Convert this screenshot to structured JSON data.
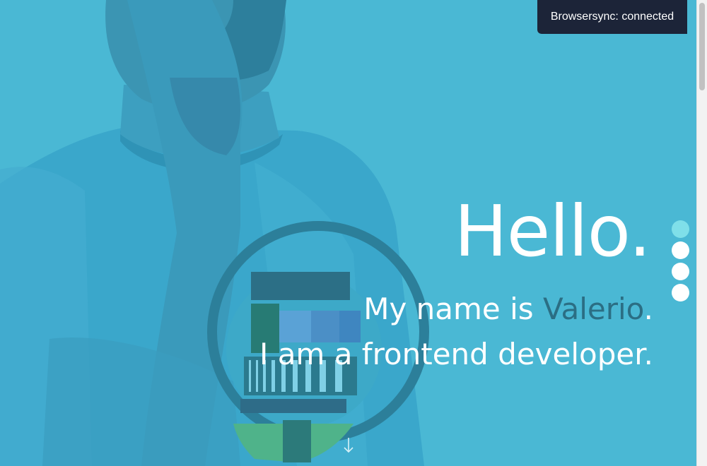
{
  "notification": {
    "text": "Browsersync: connected"
  },
  "hero": {
    "greeting": "Hello.",
    "intro_prefix": "My name is ",
    "name": "Valerio",
    "intro_suffix": ".",
    "role_line": "I am a frontend developer."
  },
  "nav_dots": {
    "count": 4,
    "active_index": 0
  },
  "icons": {
    "scroll_down": "down-arrow-icon"
  },
  "colors": {
    "background": "#4ab8d4",
    "name_highlight": "#2b6e84",
    "active_dot": "#7fdfe9",
    "notification_bg": "#1c2438"
  }
}
